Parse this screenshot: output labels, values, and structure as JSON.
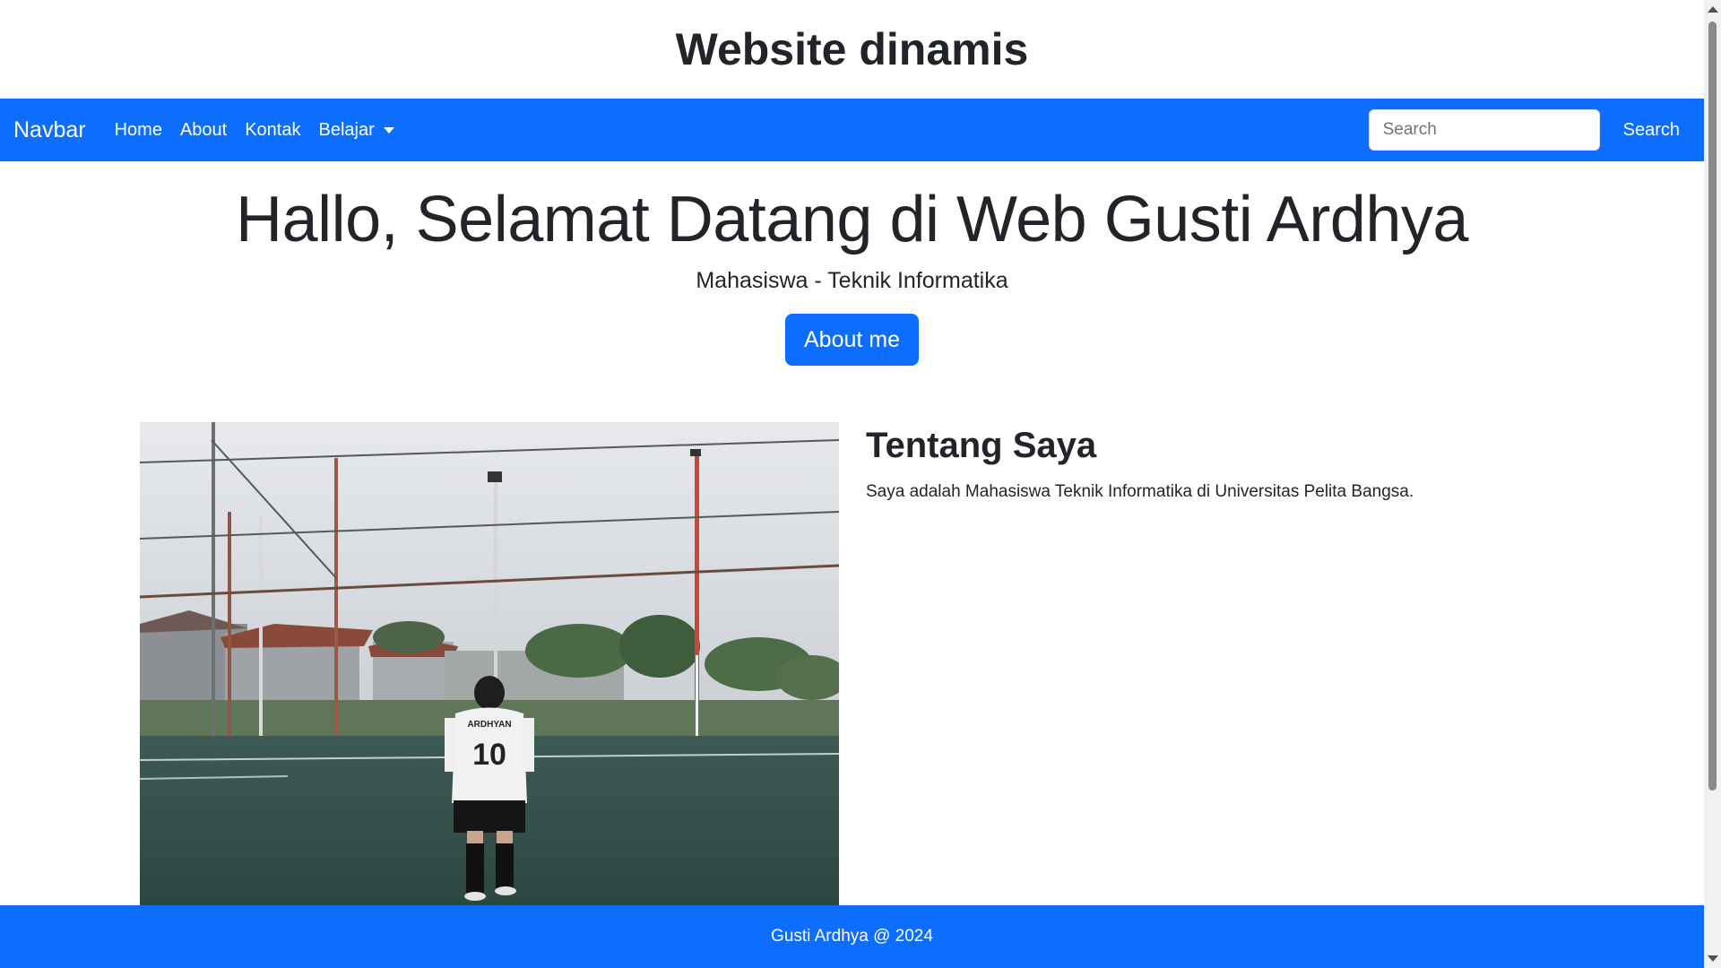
{
  "header": {
    "title": "Website dinamis"
  },
  "navbar": {
    "brand": "Navbar",
    "links": [
      {
        "label": "Home"
      },
      {
        "label": "About"
      },
      {
        "label": "Kontak"
      },
      {
        "label": "Belajar",
        "dropdown": true
      }
    ],
    "search": {
      "placeholder": "Search",
      "value": "",
      "button_label": "Search"
    }
  },
  "hero": {
    "title": "Hallo, Selamat Datang di Web Gusti Ardhya",
    "subtitle": "Mahasiswa - Teknik Informatika",
    "button_label": "About me"
  },
  "about": {
    "heading": "Tentang Saya",
    "paragraph": "Saya adalah Mahasiswa Teknik Informatika di Universitas Pelita Bangsa.",
    "photo": {
      "jersey_name": "ARDHYAN",
      "jersey_number": "10"
    }
  },
  "footer": {
    "text": "Gusti Ardhya @ 2024"
  },
  "colors": {
    "primary": "#0d6efd",
    "text": "#212529",
    "background": "#ffffff"
  },
  "icons": {
    "dropdown": "caret-down-icon"
  }
}
